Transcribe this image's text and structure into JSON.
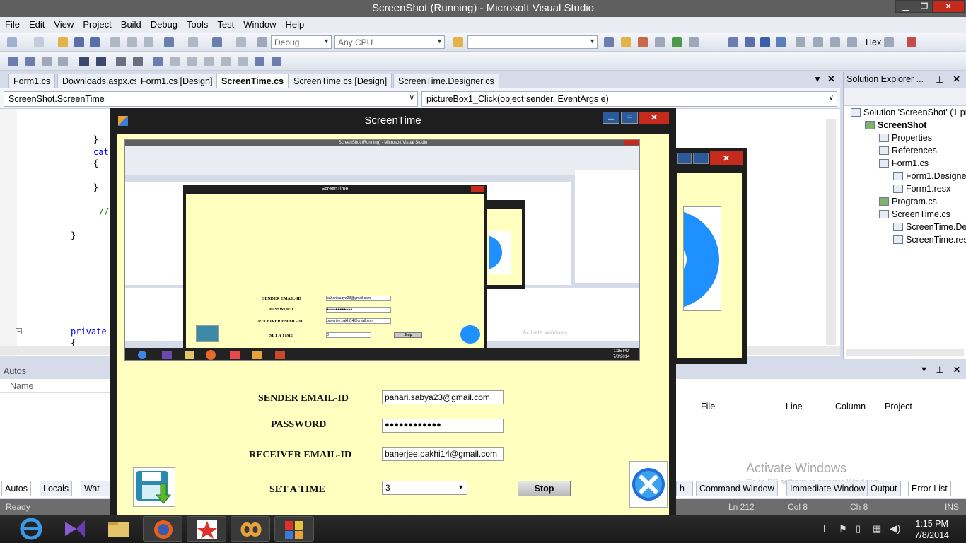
{
  "vs": {
    "title": "ScreenShot (Running) - Microsoft Visual Studio",
    "menu": [
      "File",
      "Edit",
      "View",
      "Project",
      "Build",
      "Debug",
      "Tools",
      "Test",
      "Window",
      "Help"
    ],
    "config_combo": "Debug",
    "platform_combo": "Any CPU",
    "hex_label": "Hex",
    "doc_tabs": [
      "Form1.cs",
      "Downloads.aspx.cs",
      "Form1.cs [Design]",
      "ScreenTime.cs",
      "ScreenTime.cs [Design]",
      "ScreenTime.Designer.cs"
    ],
    "class_combo": "ScreenShot.ScreenTime",
    "member_combo": "pictureBox1_Click(object sender, EventArgs e)",
    "code": {
      "l1": "}",
      "l2": "cat",
      "l3": "{",
      "l4": "}",
      "l5": "//",
      "l6": "}",
      "l7": "private",
      "l8": "{"
    },
    "solution_explorer": {
      "title": "Solution Explorer ...",
      "items": [
        "Solution 'ScreenShot' (1 pr",
        "ScreenShot",
        "Properties",
        "References",
        "Form1.cs",
        "Form1.Designer",
        "Form1.resx",
        "Program.cs",
        "ScreenTime.cs",
        "ScreenTime.Des",
        "ScreenTime.resx"
      ]
    },
    "autos": {
      "title": "Autos",
      "column": "Name"
    },
    "error_list_columns": [
      "File",
      "Line",
      "Column",
      "Project"
    ],
    "bottom_tabs_left": [
      "Autos",
      "Locals",
      "Wat"
    ],
    "bottom_tabs_right": [
      "h",
      "Command Window",
      "Immediate Window",
      "Output",
      "Error List"
    ],
    "status": {
      "ready": "Ready",
      "ln": "Ln 212",
      "col": "Col 8",
      "ch": "Ch 8",
      "ins": "INS"
    },
    "watermark": "Activate Windows",
    "watermark_sub": "Go to PC settings to activate Windows."
  },
  "screen_time": {
    "title": "ScreenTime",
    "sender_label": "SENDER EMAIL-ID",
    "sender_value": "pahari.sabya23@gmail.com",
    "password_label": "PASSWORD",
    "password_value": "●●●●●●●●●●●●",
    "receiver_label": "RECEIVER EMAIL-ID",
    "receiver_value": "banerjee.pakhi14@gmail.com",
    "time_label": "SET A TIME",
    "time_value": "3",
    "stop_label": "Stop"
  },
  "thumb": {
    "title": "ScreenShot (Running) - Microsoft Visual Studio",
    "form_title": "ScreenTime",
    "sender_label": "SENDER EMAIL-ID",
    "sender_value": "pahari.sabya23@gmail.com",
    "password_label": "PASSWORD",
    "password_value": "●●●●●●●●●●●●",
    "receiver_label": "RECEIVER EMAIL-ID",
    "receiver_value": "banerjee.pakhi14@gmail.com",
    "time_label": "SET A TIME",
    "time_value": "3",
    "stop_label": "Stop",
    "clock_time": "1:15 PM",
    "clock_date": "7/8/2014",
    "watermark": "Activate Windows"
  },
  "taskbar": {
    "time": "1:15 PM",
    "date": "7/8/2014",
    "apps": [
      "internet-explorer-icon",
      "visual-studio-icon",
      "file-explorer-icon",
      "firefox-icon",
      "star-app-icon",
      "infinity-app-icon",
      "color-blocks-app-icon"
    ]
  },
  "colors": {
    "form_bg": "#ffffc0",
    "titlebar": "#5f5f5f",
    "close_red": "#c42b1c",
    "accent_blue": "#1e90ff"
  }
}
